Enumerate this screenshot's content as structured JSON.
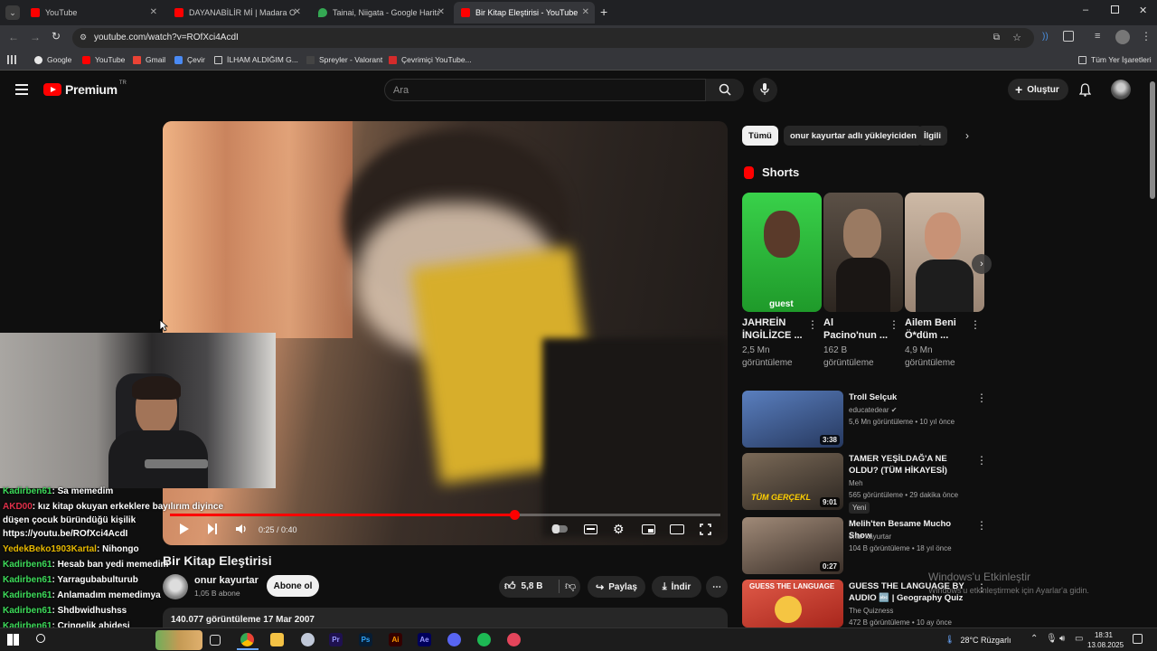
{
  "browser": {
    "tabs": [
      {
        "title": "YouTube",
        "icon": "youtube-icon"
      },
      {
        "title": "DAYANABİLİR Mİ | Madara Oldu",
        "icon": "youtube-icon"
      },
      {
        "title": "Tainai, Niigata - Google Haritalar",
        "icon": "maps-pin-icon"
      },
      {
        "title": "Bir Kitap Eleştirisi - YouTube",
        "icon": "youtube-icon",
        "active": true
      }
    ],
    "url": "youtube.com/watch?v=ROfXci4AcdI",
    "bookmarks": [
      "Google",
      "YouTube",
      "Gmail",
      "Çevir",
      "İLHAM ALDIĞIM G...",
      "Spreyler - Valorant",
      "Çevrimiçi YouTube..."
    ],
    "all_bookmarks": "Tüm Yer İşaretleri"
  },
  "header": {
    "logo": "Premium",
    "logo_sup": "TR",
    "search_placeholder": "Ara",
    "create": "Oluştur"
  },
  "player": {
    "time": "0:25 / 0:40",
    "progress": 0.625
  },
  "chat": [
    {
      "user": "Kadirben61",
      "color": "#3ddc5a",
      "msg": ": Sa memedim"
    },
    {
      "user": "AKD00",
      "color": "#e0304a",
      "msg": ": kız kitap okuyan erkeklere bayılırım diyince"
    },
    {
      "user": "",
      "color": "#ffffff",
      "msg": "düşen çocuk büründüğü kişilik"
    },
    {
      "user": "",
      "color": "#ffffff",
      "msg": "https://youtu.be/ROfXci4AcdI"
    },
    {
      "user": "YedekBeko1903Kartal",
      "color": "#e6b800",
      "msg": ": Nihongo"
    },
    {
      "user": "Kadirben61",
      "color": "#3ddc5a",
      "msg": ": Hesab ban yedi memedim"
    },
    {
      "user": "Kadirben61",
      "color": "#3ddc5a",
      "msg": ": Yarragubabulturub"
    },
    {
      "user": "Kadirben61",
      "color": "#3ddc5a",
      "msg": ": Anlamadım memedimya"
    },
    {
      "user": "Kadirben61",
      "color": "#3ddc5a",
      "msg": ": Shdbwidhushss"
    },
    {
      "user": "Kadirben61",
      "color": "#3ddc5a",
      "msg": ": Cringelik abidesi"
    },
    {
      "user": "Kadirben61",
      "color": "#3ddc5a",
      "msg": ": Sowjwjdiejbfoeje"
    }
  ],
  "video": {
    "title": "Bir Kitap Eleştirisi",
    "channel": "onur kayurtar",
    "subscribers": "1,05 B abone",
    "subscribe": "Abone ol",
    "likes": "5,8 B",
    "share": "Paylaş",
    "download": "İndir",
    "views_date": "140.077 görüntüleme  17 Mar 2007"
  },
  "filters": [
    "Tümü",
    "onur kayurtar adlı yükleyiciden",
    "İlgili"
  ],
  "shorts": {
    "heading": "Shorts",
    "items": [
      {
        "title": "JAHREİN İNGİLİZCE ...",
        "views": "2,5 Mn görüntüleme",
        "color": "#2fbf3a"
      },
      {
        "title": "Al Pacino'nun ...",
        "views": "162 B görüntüleme",
        "color": "#3a3128"
      },
      {
        "title": "Ailem Beni Ö*düm ...",
        "views": "4,9 Mn görüntüleme",
        "color": "#b49a86"
      }
    ]
  },
  "recommended": [
    {
      "title": "Troll Selçuk",
      "channel": "educatedear",
      "meta": "5,6 Mn görüntüleme • 10 yıl önce",
      "duration": "3:38",
      "color": "#3b5a8a"
    },
    {
      "title": "TAMER YEŞİLDAĞ'A NE OLDU? (TÜM HİKAYESİ)",
      "channel": "Meh",
      "meta": "565 görüntüleme • 29 dakika önce",
      "badge": "Yeni",
      "duration": "9:01",
      "color": "#5a4a3a"
    },
    {
      "title": "Melih'ten Besame Mucho Show",
      "channel": "onur kayurtar",
      "meta": "104 B görüntüleme • 18 yıl önce",
      "duration": "0:27",
      "color": "#6a5a4f"
    },
    {
      "title": "GUESS THE LANGUAGE BY AUDIO 🔤 | Geography Quiz",
      "channel": "The Quizness",
      "meta": "472 B görüntüleme • 10 ay önce",
      "duration": "",
      "color": "#d2443a"
    }
  ],
  "watermark": {
    "line1": "Windows'u Etkinleştir",
    "line2": "Windows'u etkinleştirmek için Ayarlar'a gidin."
  },
  "taskbar": {
    "weather": "28°C  Rüzgarlı",
    "time": "18:31",
    "date": "13.08.2025"
  }
}
